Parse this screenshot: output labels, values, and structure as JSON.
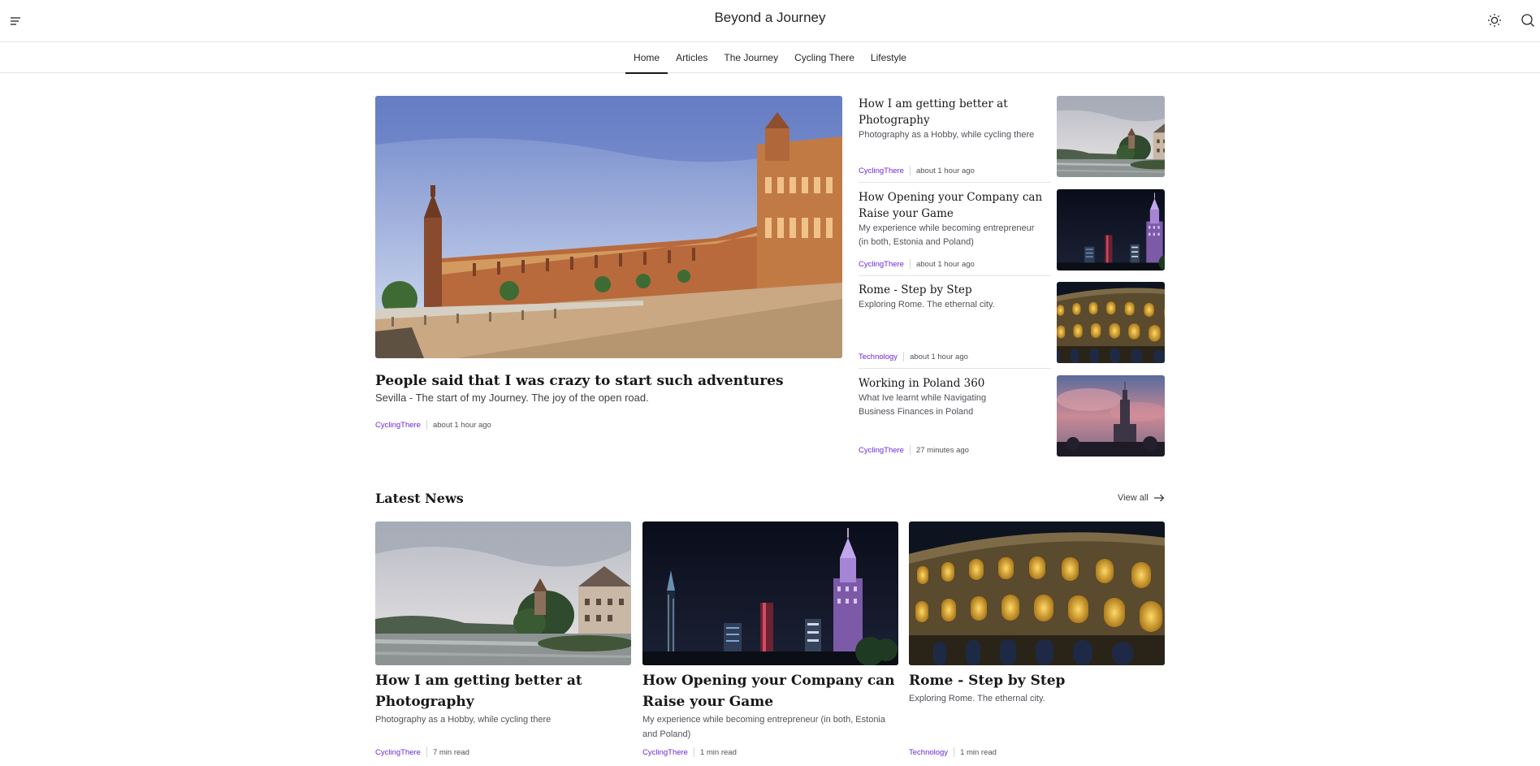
{
  "header": {
    "title": "Beyond a Journey",
    "menu_icon": "hamburger-menu-icon",
    "theme_icon": "sun-icon",
    "search_icon": "search-icon"
  },
  "nav": {
    "tabs": [
      {
        "label": "Home",
        "active": true
      },
      {
        "label": "Articles"
      },
      {
        "label": "The Journey"
      },
      {
        "label": "Cycling There"
      },
      {
        "label": "Lifestyle"
      }
    ]
  },
  "hero": {
    "title": "People said that I was crazy to start such adventures",
    "subtitle": "Sevilla - The start of my Journey. The joy of the open road.",
    "category": "CyclingThere",
    "time": "about 1 hour ago"
  },
  "side_articles": [
    {
      "title": "How I am getting better at Photography",
      "subtitle": "Photography as a Hobby, while cycling there",
      "category": "CyclingThere",
      "time": "about 1 hour ago"
    },
    {
      "title": "How Opening your Company can Raise your Game",
      "subtitle": "My experience while becoming entrepreneur (in both, Estonia and Poland)",
      "category": "CyclingThere",
      "time": "about 1 hour ago"
    },
    {
      "title": "Rome - Step by Step",
      "subtitle": "Exploring Rome. The ethernal city.",
      "category": "Technology",
      "time": "about 1 hour ago"
    },
    {
      "title": "Working in Poland 360",
      "subtitle": "What Ive learnt while Navigating Business Finances in Poland",
      "category": "CyclingThere",
      "time": "27 minutes ago"
    }
  ],
  "latest": {
    "heading": "Latest News",
    "view_all": "View all",
    "cards": [
      {
        "title": "How I am getting better at Photography",
        "subtitle": "Photography as a Hobby, while cycling there",
        "category": "CyclingThere",
        "read_time": "7 min read"
      },
      {
        "title": "How Opening your Company can Raise your Game",
        "subtitle": "My experience while becoming entrepreneur (in both, Estonia and Poland)",
        "category": "CyclingThere",
        "read_time": "1 min read"
      },
      {
        "title": "Rome - Step by Step",
        "subtitle": "Exploring Rome. The ethernal city.",
        "category": "Technology",
        "read_time": "1 min read"
      }
    ]
  },
  "colors": {
    "accent": "#6d28d9",
    "border": "#e4e4e7",
    "text": "#18181b"
  }
}
